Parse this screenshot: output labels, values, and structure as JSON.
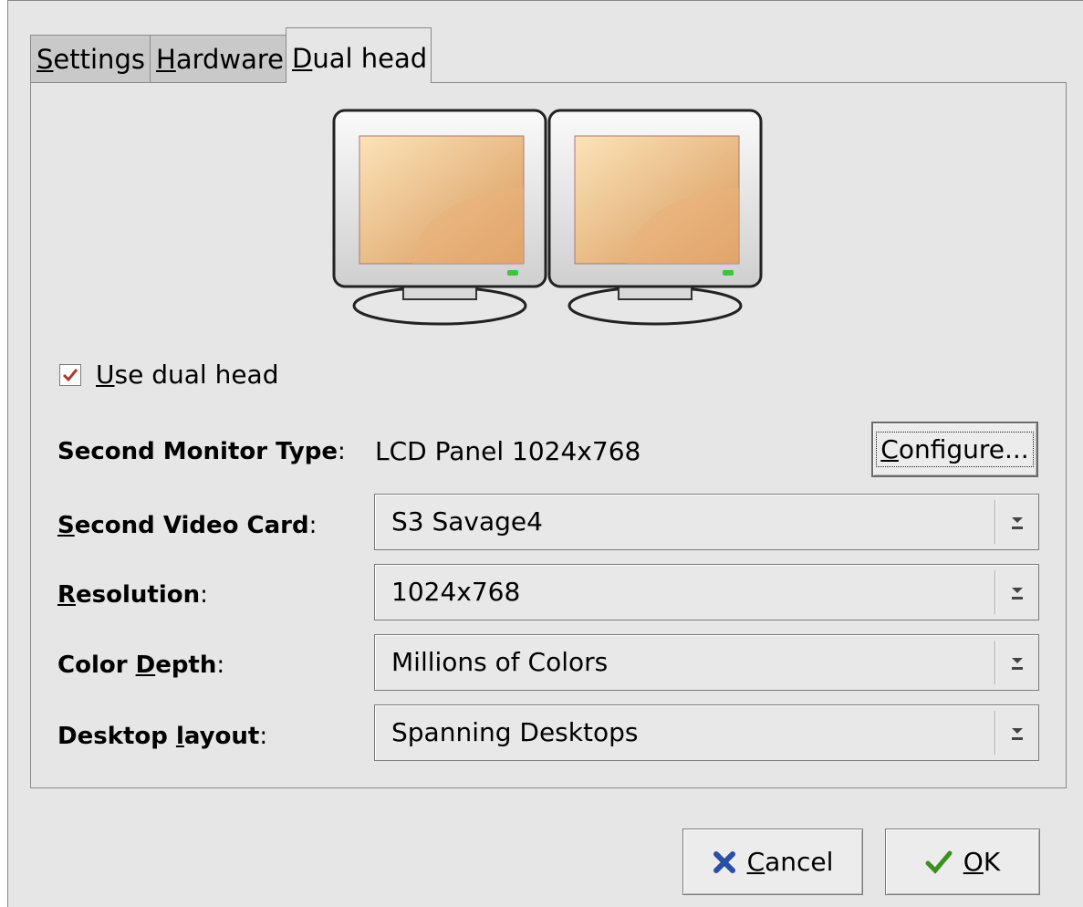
{
  "tabs": [
    {
      "label_u": "S",
      "label_rest": "ettings"
    },
    {
      "label_u": "H",
      "label_rest": "ardware"
    },
    {
      "label_u": "D",
      "label_rest": "ual head"
    }
  ],
  "checkbox": {
    "checked": true,
    "label_u": "U",
    "label_rest": "se dual head"
  },
  "second_monitor": {
    "label": "Second Monitor Type",
    "value": "LCD Panel 1024x768",
    "configure_u": "C",
    "configure_rest": "onfigure..."
  },
  "video_card": {
    "label_u": "S",
    "label_rest": "econd Video Card",
    "value": "S3 Savage4"
  },
  "resolution": {
    "label_u": "R",
    "label_rest": "esolution",
    "value": "1024x768"
  },
  "color_depth": {
    "label_pre": "Color ",
    "label_u": "D",
    "label_rest": "epth",
    "value": "Millions of Colors"
  },
  "desktop_layout": {
    "label_pre": "Desktop ",
    "label_u": "l",
    "label_rest": "ayout",
    "value": "Spanning Desktops"
  },
  "buttons": {
    "cancel_u": "C",
    "cancel_rest": "ancel",
    "ok_u": "O",
    "ok_rest": "K"
  },
  "icons": {
    "cancel": "x-icon",
    "ok": "checkmark-icon",
    "monitors": "dual-monitor-icon"
  },
  "colors": {
    "check": "#b03a2e",
    "ok_check": "#3d8f1e",
    "cancel_x": "#2c4fa3",
    "screen_light": "#f7d9ab",
    "screen_dark": "#d99a5c"
  }
}
